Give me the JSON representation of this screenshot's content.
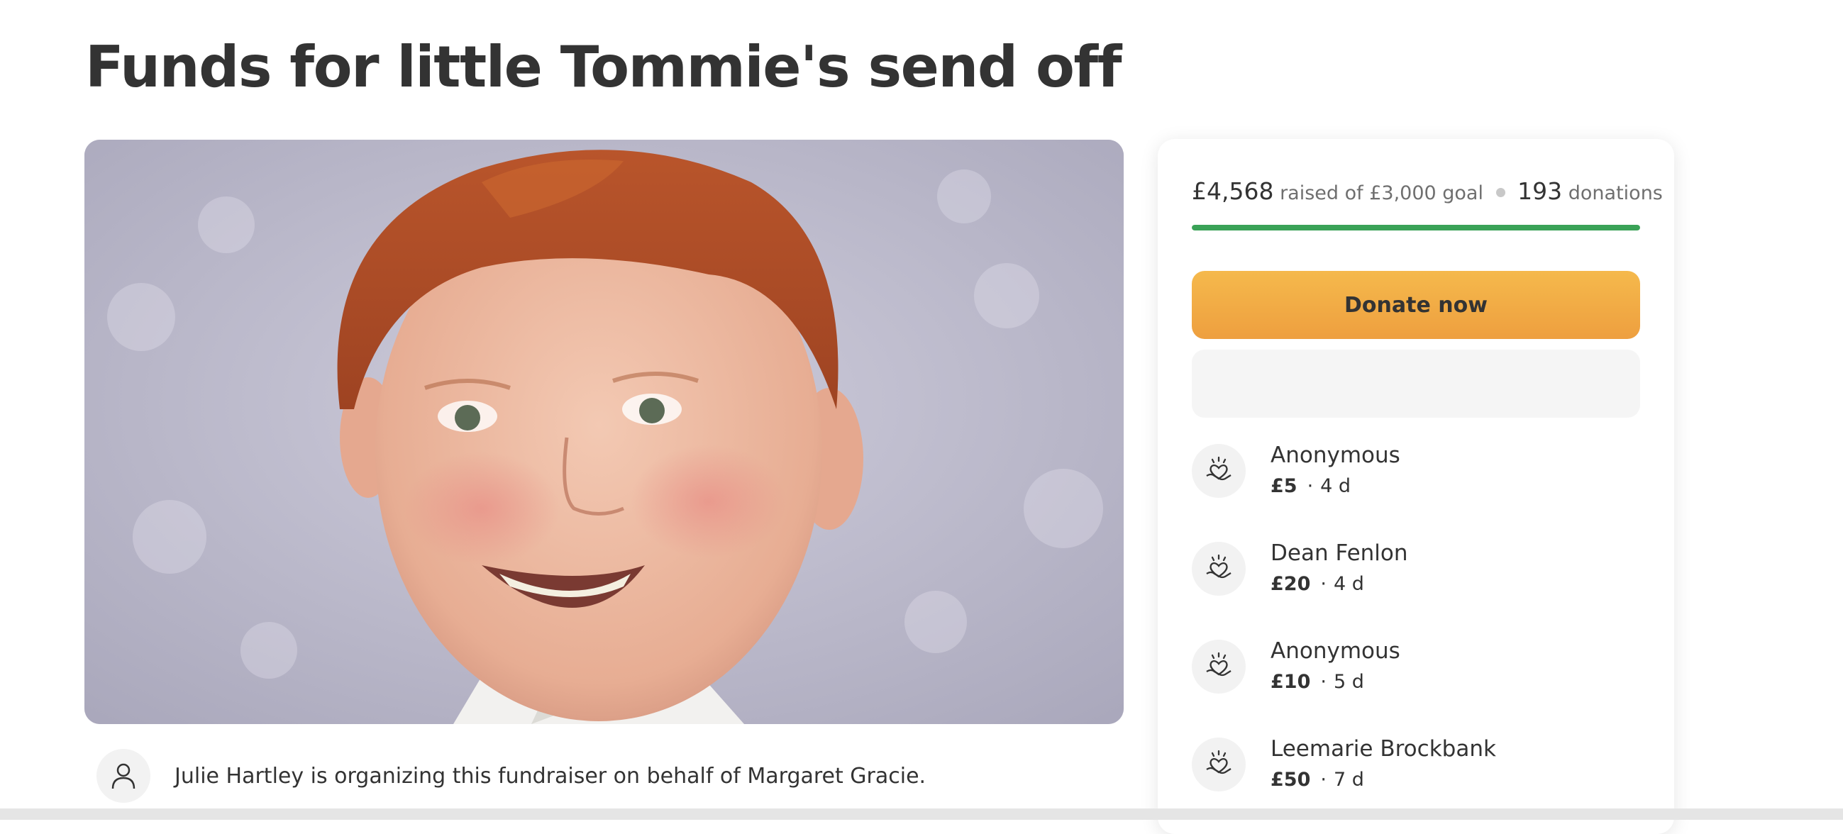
{
  "page": {
    "title": "Funds for little Tommie's send off"
  },
  "hero": {
    "icon": "child-portrait-photo"
  },
  "organizer": {
    "icon": "person-icon",
    "text": "Julie Hartley is organizing this fundraiser on behalf of Margaret Gracie."
  },
  "progress": {
    "raised": "£4,568",
    "raised_label": "raised of £3,000 goal",
    "donations_count": "193",
    "donations_label": "donations",
    "fraction": 1.0,
    "bar_color": "#3aa257"
  },
  "actions": {
    "donate_label": "Donate now",
    "donate_color": "#f0a843"
  },
  "donations": [
    {
      "name": "Anonymous",
      "amount": "£5",
      "time": "4 d"
    },
    {
      "name": "Dean Fenlon",
      "amount": "£20",
      "time": "4 d"
    },
    {
      "name": "Anonymous",
      "amount": "£10",
      "time": "5 d"
    },
    {
      "name": "Leemarie Brockbank",
      "amount": "£50",
      "time": "7 d"
    }
  ],
  "donation_separator": "·"
}
